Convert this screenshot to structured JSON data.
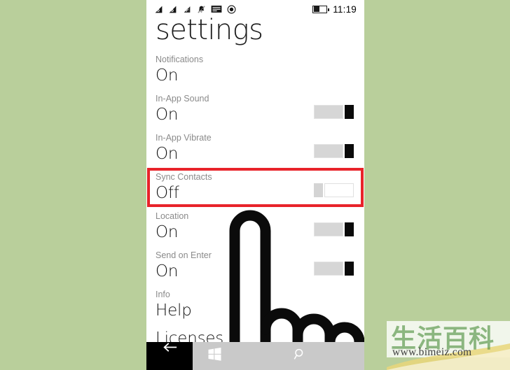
{
  "background_color": "#b9cf9b",
  "phone": {
    "status_bar": {
      "icons": [
        {
          "name": "sim1-signal-icon"
        },
        {
          "name": "sim2-signal-icon"
        },
        {
          "name": "wifi-icon"
        },
        {
          "name": "bell-muted-icon"
        },
        {
          "name": "sim-card-icon"
        },
        {
          "name": "record-dot-icon"
        }
      ],
      "battery": {
        "name": "battery-icon",
        "level_percent": 45
      },
      "clock": "11:19"
    },
    "title": "settings",
    "settings": [
      {
        "label": "Notifications",
        "value": "On",
        "toggle": null
      },
      {
        "label": "In-App Sound",
        "value": "On",
        "toggle": "on"
      },
      {
        "label": "In-App Vibrate",
        "value": "On",
        "toggle": "on"
      },
      {
        "label": "Sync Contacts",
        "value": "Off",
        "toggle": "off",
        "highlighted": true
      },
      {
        "label": "Location",
        "value": "On",
        "toggle": "on"
      },
      {
        "label": "Send on Enter",
        "value": "On",
        "toggle": "on"
      },
      {
        "label": "Info",
        "value": "Help",
        "toggle": null
      },
      {
        "label": "",
        "value": "Licenses",
        "toggle": null
      }
    ],
    "highlight_color": "#e8232a",
    "nav_bar": {
      "back_label": "back-arrow",
      "start_label": "windows-logo",
      "search_label": "search-magnifier"
    }
  },
  "watermark": {
    "characters": "生活百科",
    "url": "www.bimeiz.com",
    "color": "#4e8f3e"
  }
}
